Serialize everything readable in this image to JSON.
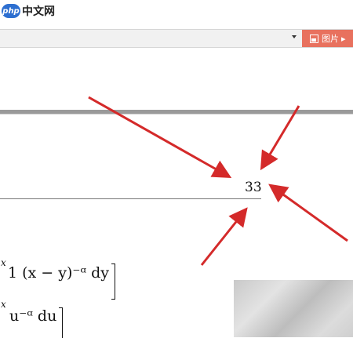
{
  "watermark": {
    "logo_badge": "php",
    "logo_text": "中文网"
  },
  "toolbar": {
    "image_button_label": "图片 ▸",
    "dropdown_icon": "caret-down-icon",
    "image_icon": "image-icon"
  },
  "document": {
    "page_number": "33",
    "formula_line1": {
      "superscript": "x",
      "body": "1 (x − y)⁻ᵅ dy"
    },
    "formula_line2": {
      "superscript": "x",
      "body": "u⁻ᵅ du"
    }
  },
  "annotations": {
    "arrow_color": "#d42a2a",
    "arrow_count": 4,
    "arrow_icon": "arrow-icon"
  }
}
